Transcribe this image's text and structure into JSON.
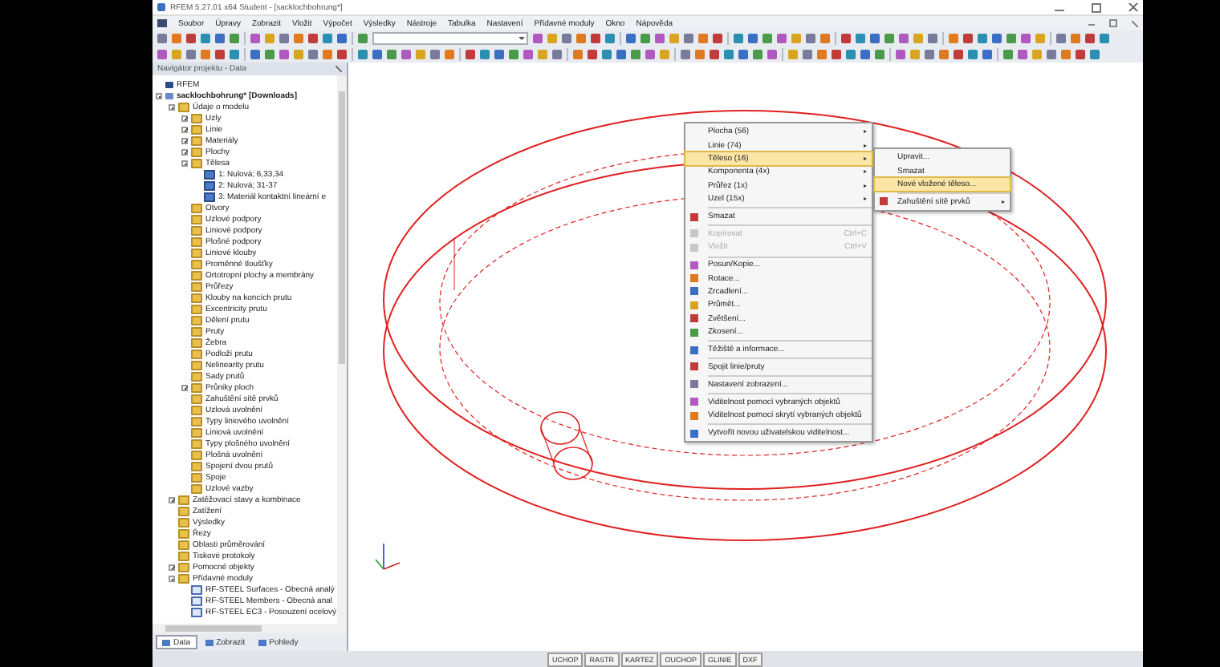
{
  "window": {
    "title": "RFEM 5.27.01 x64 Student - [sacklochbohrung*]"
  },
  "menu_bar": [
    "Soubor",
    "Úpravy",
    "Zobrazit",
    "Vložit",
    "Výpočet",
    "Výsledky",
    "Nástroje",
    "Tabulka",
    "Nastavení",
    "Přídavné moduly",
    "Okno",
    "Nápověda"
  ],
  "navigator": {
    "title": "Navigátor projektu - Data",
    "tree": [
      {
        "label": "RFEM",
        "kind": "app"
      },
      {
        "label": "sacklochbohrung* [Downloads]",
        "kind": "model",
        "bold": true,
        "expanded": true,
        "children": [
          {
            "label": "Údaje o modelu",
            "kind": "folder",
            "expanded": true,
            "children": [
              {
                "label": "Uzly",
                "kind": "folder",
                "expanded": false
              },
              {
                "label": "Linie",
                "kind": "folder",
                "expanded": false
              },
              {
                "label": "Materiály",
                "kind": "folder",
                "expanded": false
              },
              {
                "label": "Plochy",
                "kind": "folder",
                "expanded": false
              },
              {
                "label": "Tělesa",
                "kind": "folder",
                "expanded": true,
                "children": [
                  {
                    "label": "1: Nulová; 6,33,34",
                    "kind": "solid"
                  },
                  {
                    "label": "2: Nulová; 31-37",
                    "kind": "solid"
                  },
                  {
                    "label": "3: Materiál kontaktní lineární e",
                    "kind": "solid"
                  }
                ]
              },
              {
                "label": "Otvory",
                "kind": "folder"
              },
              {
                "label": "Uzlové podpory",
                "kind": "folder"
              },
              {
                "label": "Liniové podpory",
                "kind": "folder"
              },
              {
                "label": "Plošné podpory",
                "kind": "folder"
              },
              {
                "label": "Liniové klouby",
                "kind": "folder"
              },
              {
                "label": "Proměnné tloušťky",
                "kind": "folder"
              },
              {
                "label": "Ortotropní plochy a membrány",
                "kind": "folder"
              },
              {
                "label": "Průřezy",
                "kind": "folder"
              },
              {
                "label": "Klouby na koncích prutu",
                "kind": "folder"
              },
              {
                "label": "Excentricity prutu",
                "kind": "folder"
              },
              {
                "label": "Dělení prutu",
                "kind": "folder"
              },
              {
                "label": "Pruty",
                "kind": "folder"
              },
              {
                "label": "Žebra",
                "kind": "folder"
              },
              {
                "label": "Podloží prutu",
                "kind": "folder"
              },
              {
                "label": "Nelinearity prutu",
                "kind": "folder"
              },
              {
                "label": "Sady prutů",
                "kind": "folder"
              },
              {
                "label": "Průniky ploch",
                "kind": "folder",
                "expanded": false
              },
              {
                "label": "Zahuštění sítě prvků",
                "kind": "folder"
              },
              {
                "label": "Uzlová uvolnění",
                "kind": "folder"
              },
              {
                "label": "Typy liniového uvolnění",
                "kind": "folder"
              },
              {
                "label": "Liniová uvolnění",
                "kind": "folder"
              },
              {
                "label": "Typy plošného uvolnění",
                "kind": "folder"
              },
              {
                "label": "Plošná uvolnění",
                "kind": "folder"
              },
              {
                "label": "Spojení dvou prutů",
                "kind": "folder"
              },
              {
                "label": "Spoje",
                "kind": "folder"
              },
              {
                "label": "Uzlové vazby",
                "kind": "folder"
              }
            ]
          },
          {
            "label": "Zatěžovací stavy a kombinace",
            "kind": "folder",
            "expanded": false
          },
          {
            "label": "Zatížení",
            "kind": "folder"
          },
          {
            "label": "Výsledky",
            "kind": "folder"
          },
          {
            "label": "Řezy",
            "kind": "folder"
          },
          {
            "label": "Oblasti průměrování",
            "kind": "folder"
          },
          {
            "label": "Tiskové protokoly",
            "kind": "folder"
          },
          {
            "label": "Pomocné objekty",
            "kind": "folder",
            "expanded": false
          },
          {
            "label": "Přídavné moduly",
            "kind": "folder",
            "expanded": true,
            "children": [
              {
                "label": "RF-STEEL Surfaces - Obecná analý",
                "kind": "module"
              },
              {
                "label": "RF-STEEL Members - Obecná anal",
                "kind": "module"
              },
              {
                "label": "RF-STEEL EC3 - Posouzení ocelový",
                "kind": "module"
              }
            ]
          }
        ]
      }
    ],
    "tabs": [
      {
        "label": "Data",
        "selected": true
      },
      {
        "label": "Zobrazit",
        "selected": false
      },
      {
        "label": "Pohledy",
        "selected": false
      }
    ]
  },
  "context_menu": [
    [
      {
        "label": "Plocha (56)",
        "submenu": true
      },
      {
        "label": "Linie (74)",
        "submenu": true
      },
      {
        "label": "Těleso (16)",
        "submenu": true,
        "selected": true
      },
      {
        "label": "Komponenta (4x)",
        "submenu": true
      },
      {
        "label": "Průřez (1x)",
        "submenu": true
      },
      {
        "label": "Uzel (15x)",
        "submenu": true
      }
    ],
    [
      {
        "label": "Smazat"
      }
    ],
    [
      {
        "label": "Kopírovat",
        "shortcut": "Ctrl+C",
        "disabled": true
      },
      {
        "label": "Vložit",
        "shortcut": "Ctrl+V",
        "disabled": true
      }
    ],
    [
      {
        "label": "Posun/Kopie..."
      },
      {
        "label": "Rotace..."
      },
      {
        "label": "Zrcadlení..."
      },
      {
        "label": "Průmět..."
      },
      {
        "label": "Zvětšení..."
      },
      {
        "label": "Zkosení..."
      }
    ],
    [
      {
        "label": "Těžiště a informace..."
      }
    ],
    [
      {
        "label": "Spojit linie/pruty"
      }
    ],
    [
      {
        "label": "Nastavení zobrazení..."
      }
    ],
    [
      {
        "label": "Viditelnost pomocí vybraných objektů"
      },
      {
        "label": "Viditelnost pomocí skrytí vybraných objektů"
      }
    ],
    [
      {
        "label": "Vytvořit novou uživatelskou viditelnost..."
      }
    ]
  ],
  "submenu": [
    [
      {
        "label": "Upravit..."
      },
      {
        "label": "Smazat"
      },
      {
        "label": "Nové vložené těleso...",
        "selected": true
      }
    ],
    [
      {
        "label": "Zahuštění sítě prvků",
        "submenu": true
      }
    ]
  ],
  "status_bar": [
    "UCHOP",
    "RASTR",
    "KARTEZ",
    "OUCHOP",
    "GLINIE",
    "DXF"
  ]
}
